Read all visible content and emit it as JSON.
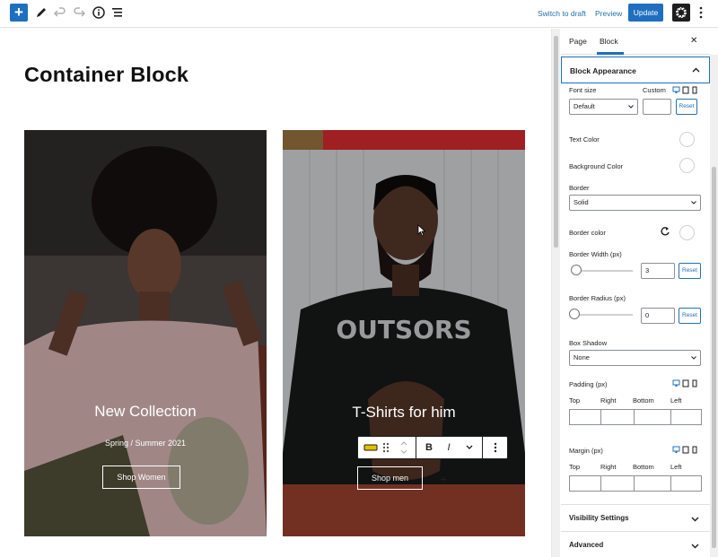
{
  "toolbar": {
    "switch_to_draft": "Switch to draft",
    "preview": "Preview",
    "update": "Update",
    "add_icon": "plus-icon",
    "accent": "#1e6fbf"
  },
  "page": {
    "title": "Container Block"
  },
  "cards": [
    {
      "heading": "New Collection",
      "subheading": "Spring / Summer 2021",
      "button": "Shop Women"
    },
    {
      "heading": "T-Shirts for him",
      "button": "Shop men"
    }
  ],
  "block_toolbar": {
    "bold": "B",
    "italic": "I"
  },
  "sidebar": {
    "tabs": [
      "Page",
      "Block"
    ],
    "active_tab": "Block",
    "panel_title": "Block Appearance",
    "font_size": {
      "label": "Font size",
      "custom_label": "Custom",
      "value": "Default",
      "reset": "Reset"
    },
    "text_color_label": "Text Color",
    "background_color_label": "Background Color",
    "border": {
      "label": "Border",
      "value": "Solid"
    },
    "border_color_label": "Border color",
    "border_width": {
      "label": "Border Width (px)",
      "value": "3",
      "reset": "Reset"
    },
    "border_radius": {
      "label": "Border Radius (px)",
      "value": "0",
      "reset": "Reset"
    },
    "box_shadow": {
      "label": "Box Shadow",
      "value": "None"
    },
    "padding": {
      "label": "Padding (px)",
      "top": "Top",
      "right": "Right",
      "bottom": "Bottom",
      "left": "Left"
    },
    "margin": {
      "label": "Margin (px)",
      "top": "Top",
      "right": "Right",
      "bottom": "Bottom",
      "left": "Left"
    },
    "visibility_label": "Visibility Settings",
    "advanced_label": "Advanced"
  }
}
